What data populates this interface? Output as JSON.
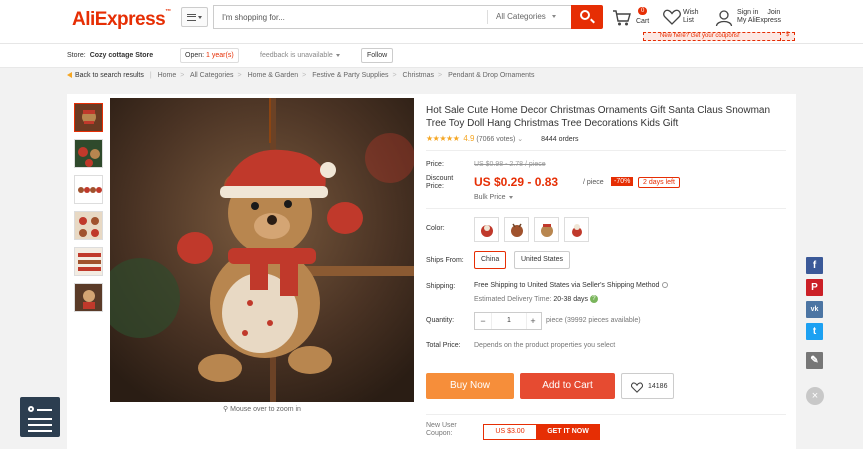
{
  "header": {
    "logo": "AliExpress",
    "search_placeholder": "I'm shopping for...",
    "search_category": "All Categories",
    "cart_count": "0",
    "cart_label": "Cart",
    "wish_label_1": "Wish",
    "wish_label_2": "List",
    "sign_in": "Sign in",
    "join": "Join",
    "my_aliexpress": "My AliExpress",
    "coupon_text": "New here? Get your coupons!",
    "coupon_symbol": "$"
  },
  "store": {
    "label": "Store:",
    "name": "Cozy cottage Store",
    "open_prefix": "Open:",
    "open_years": "1 year(s)",
    "feedback": "feedback is unavailable",
    "follow": "Follow"
  },
  "breadcrumb": {
    "back": "Back to search results",
    "items": [
      "Home",
      "All Categories",
      "Home & Garden",
      "Festive & Party Supplies",
      "Christmas",
      "Pendant & Drop Ornaments"
    ]
  },
  "gallery": {
    "zoom_tip": "Mouse over to zoom in"
  },
  "product": {
    "title": "Hot Sale Cute Home Decor Christmas Ornaments Gift Santa Claus Snowman Tree Toy Doll Hang Christmas Tree Decorations Kids Gift",
    "stars": "★★★★★",
    "rating": "4.9",
    "votes": "(7066 votes)",
    "orders": "8444 orders",
    "price_label": "Price:",
    "price_old": "US $0.98 - 2.78 / piece",
    "discount_label_1": "Discount",
    "discount_label_2": "Price:",
    "price_new": "US $0.29 - 0.83",
    "price_unit": "/ piece",
    "discount_pct": "-70%",
    "days_left": "2 days left",
    "bulk_price": "Bulk Price",
    "color_label": "Color:",
    "ships_from_label": "Ships From:",
    "ships_from_options": [
      "China",
      "United States"
    ],
    "shipping_label": "Shipping:",
    "shipping_text": "Free Shipping to United States via Seller's Shipping Method",
    "delivery_prefix": "Estimated Delivery Time:",
    "delivery_days": "20-38 days",
    "quantity_label": "Quantity:",
    "quantity_minus": "−",
    "quantity_value": "1",
    "quantity_plus": "+",
    "quantity_info": "piece (39992 pieces available)",
    "total_label": "Total Price:",
    "total_info": "Depends on the product properties you select",
    "buy_now": "Buy Now",
    "add_to_cart": "Add to Cart",
    "wish_count": "14186",
    "new_user_label": "New User Coupon:",
    "coupon_amount": "US $3.00",
    "coupon_get": "GET IT NOW"
  },
  "social": {
    "facebook": "f",
    "pinterest": "P",
    "vk": "vk",
    "twitter": "t"
  },
  "colors": {
    "brand": "#e62e04",
    "buy_now": "#f68e3a",
    "add_to_cart": "#e64b31"
  }
}
